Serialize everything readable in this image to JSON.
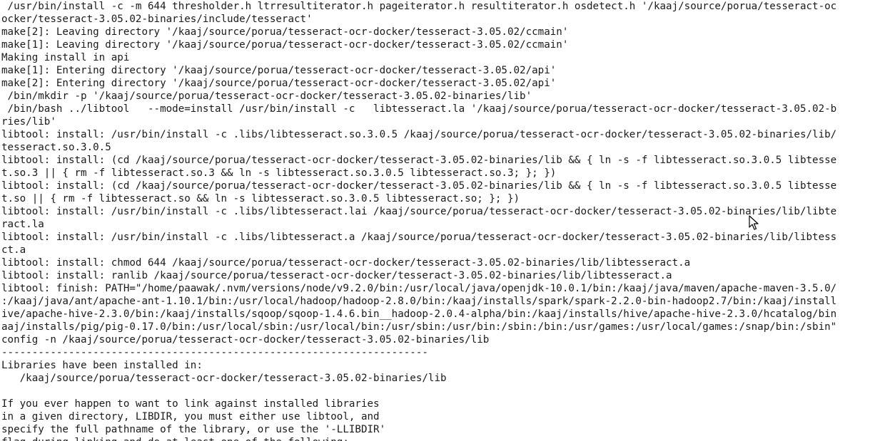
{
  "terminal": {
    "lines": [
      " /usr/bin/install -c -m 644 thresholder.h ltrresultiterator.h pageiterator.h resultiterator.h osdetect.h '/kaaj/source/porua/tesseract-oc",
      "ocker/tesseract-3.05.02-binaries/include/tesseract'",
      "make[2]: Leaving directory '/kaaj/source/porua/tesseract-ocr-docker/tesseract-3.05.02/ccmain'",
      "make[1]: Leaving directory '/kaaj/source/porua/tesseract-ocr-docker/tesseract-3.05.02/ccmain'",
      "Making install in api",
      "make[1]: Entering directory '/kaaj/source/porua/tesseract-ocr-docker/tesseract-3.05.02/api'",
      "make[2]: Entering directory '/kaaj/source/porua/tesseract-ocr-docker/tesseract-3.05.02/api'",
      " /bin/mkdir -p '/kaaj/source/porua/tesseract-ocr-docker/tesseract-3.05.02-binaries/lib'",
      " /bin/bash ../libtool   --mode=install /usr/bin/install -c   libtesseract.la '/kaaj/source/porua/tesseract-ocr-docker/tesseract-3.05.02-b",
      "ries/lib'",
      "libtool: install: /usr/bin/install -c .libs/libtesseract.so.3.0.5 /kaaj/source/porua/tesseract-ocr-docker/tesseract-3.05.02-binaries/lib/",
      "tesseract.so.3.0.5",
      "libtool: install: (cd /kaaj/source/porua/tesseract-ocr-docker/tesseract-3.05.02-binaries/lib && { ln -s -f libtesseract.so.3.0.5 libtesse",
      "t.so.3 || { rm -f libtesseract.so.3 && ln -s libtesseract.so.3.0.5 libtesseract.so.3; }; })",
      "libtool: install: (cd /kaaj/source/porua/tesseract-ocr-docker/tesseract-3.05.02-binaries/lib && { ln -s -f libtesseract.so.3.0.5 libtesse",
      "t.so || { rm -f libtesseract.so && ln -s libtesseract.so.3.0.5 libtesseract.so; }; })",
      "libtool: install: /usr/bin/install -c .libs/libtesseract.lai /kaaj/source/porua/tesseract-ocr-docker/tesseract-3.05.02-binaries/lib/libte",
      "ract.la",
      "libtool: install: /usr/bin/install -c .libs/libtesseract.a /kaaj/source/porua/tesseract-ocr-docker/tesseract-3.05.02-binaries/lib/libtess",
      "ct.a",
      "libtool: install: chmod 644 /kaaj/source/porua/tesseract-ocr-docker/tesseract-3.05.02-binaries/lib/libtesseract.a",
      "libtool: install: ranlib /kaaj/source/porua/tesseract-ocr-docker/tesseract-3.05.02-binaries/lib/libtesseract.a",
      "libtool: finish: PATH=\"/home/paawak/.nvm/versions/node/v9.2.0/bin:/usr/local/java/openjdk-10.0.1/bin:/kaaj/java/maven/apache-maven-3.5.0/",
      ":/kaaj/java/ant/apache-ant-1.10.1/bin:/usr/local/hadoop/hadoop-2.8.0/bin:/kaaj/installs/spark/spark-2.2.0-bin-hadoop2.7/bin:/kaaj/install",
      "ive/apache-hive-2.3.0/bin:/kaaj/installs/sqoop/sqoop-1.4.6.bin__hadoop-2.0.4-alpha/bin:/kaaj/installs/hive/apache-hive-2.3.0/hcatalog/bin",
      "aaj/installs/pig/pig-0.17.0/bin:/usr/local/sbin:/usr/local/bin:/usr/sbin:/usr/bin:/sbin:/bin:/usr/games:/usr/local/games:/snap/bin:/sbin\"",
      "config -n /kaaj/source/porua/tesseract-ocr-docker/tesseract-3.05.02-binaries/lib",
      "----------------------------------------------------------------------",
      "Libraries have been installed in:",
      "   /kaaj/source/porua/tesseract-ocr-docker/tesseract-3.05.02-binaries/lib",
      "",
      "If you ever happen to want to link against installed libraries",
      "in a given directory, LIBDIR, you must either use libtool, and",
      "specify the full pathname of the library, or use the '-LLIBDIR'",
      "flag during linking and do at least one of the following:"
    ]
  },
  "cursor": {
    "icon": "mouse-pointer-icon"
  }
}
